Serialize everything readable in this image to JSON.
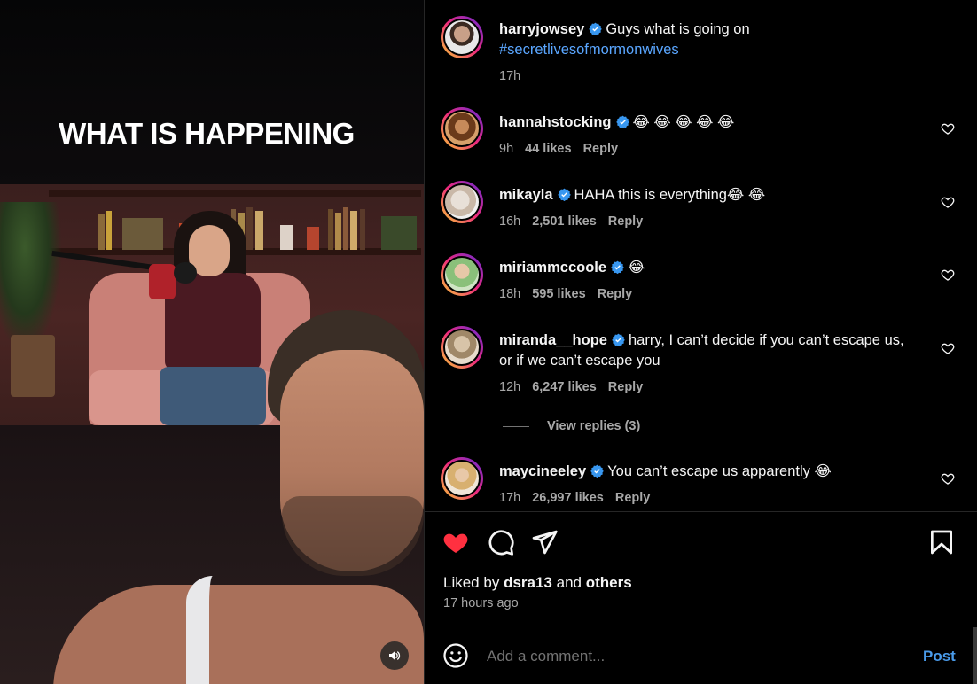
{
  "media": {
    "caption_overlay": "WHAT IS HAPPENING",
    "icons": {
      "audio": "speaker-icon"
    }
  },
  "comments": [
    {
      "username": "harryjowsey",
      "verified": true,
      "text": "Guys what is going on",
      "hashtag": "#secretlivesofmormonwives",
      "time": "17h",
      "is_caption": true
    },
    {
      "username": "hannahstocking",
      "verified": true,
      "text": "😂 😂 😂 😂 😂",
      "time": "9h",
      "likes": "44 likes",
      "reply": "Reply"
    },
    {
      "username": "mikayla",
      "verified": true,
      "text": "HAHA this is everything😂 😂",
      "time": "16h",
      "likes": "2,501 likes",
      "reply": "Reply"
    },
    {
      "username": "miriammccoole",
      "verified": true,
      "text": "😂",
      "time": "18h",
      "likes": "595 likes",
      "reply": "Reply"
    },
    {
      "username": "miranda__hope",
      "verified": true,
      "text": "harry, I can’t decide if you can’t escape us,",
      "text2": "or if we can’t escape you",
      "time": "12h",
      "likes": "6,247 likes",
      "reply": "Reply",
      "view_replies": "View replies (3)"
    },
    {
      "username": "maycineeley",
      "verified": true,
      "text": "You can’t escape us apparently 😂",
      "time": "17h",
      "likes": "26,997 likes",
      "reply": "Reply"
    }
  ],
  "actions": {
    "icons": [
      "heart-filled-icon",
      "comment-icon",
      "share-icon",
      "bookmark-icon"
    ],
    "liked_prefix": "Liked by",
    "liked_user": "dsra13",
    "liked_and": "and",
    "liked_others": "others",
    "time_ago": "17 hours ago"
  },
  "composer": {
    "placeholder": "Add a comment...",
    "post_label": "Post"
  },
  "colors": {
    "accent": "#4a9bea",
    "heart": "#ff3040",
    "verified": "#3897f0",
    "muted": "#a8a8a8"
  }
}
